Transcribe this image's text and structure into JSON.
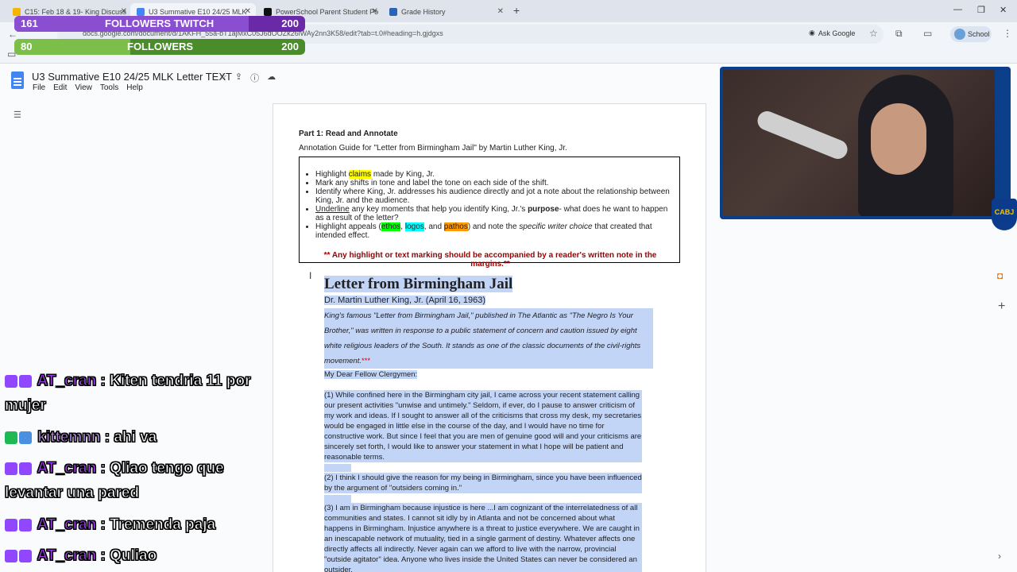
{
  "browser": {
    "tabs": [
      {
        "label": "C15: Feb 18 & 19- King Discuss",
        "color": "#f4b400"
      },
      {
        "label": "U3 Summative E10 24/25 MLK",
        "color": "#4285f4"
      },
      {
        "label": "PowerSchool Parent Student Po",
        "color": "#111111"
      },
      {
        "label": "Grade History",
        "color": "#2a63b5"
      }
    ],
    "url": "docs.google.com/document/d/1AKFH_55a-bT1ajMxC05J6dOOZk26lWAy2nn3K58/edit?tab=t.0#heading=h.gjdgxs",
    "ask_google": "Ask Google",
    "profile": "School"
  },
  "overlay": {
    "twitch": {
      "current": "161",
      "label": "FOLLOWERS TWITCH",
      "goal": "200",
      "progress": 0.805
    },
    "followers": {
      "current": "80",
      "label": "FOLLOWERS",
      "goal": "200",
      "progress": 0.4
    }
  },
  "docs": {
    "title": "U3 Summative E10 24/25 MLK Letter TEXT",
    "menu": [
      "File",
      "Edit",
      "View",
      "Tools",
      "Help"
    ]
  },
  "document": {
    "part_title": "Part 1: Read and Annotate",
    "guide_title": "Annotation Guide for \"Letter from Birmingham Jail\" by Martin Luther King, Jr.",
    "bullets": {
      "b1_pre": "Highlight ",
      "b1_claims": "claims",
      "b1_post": " made by King, Jr.",
      "b2": "Mark any shifts in tone and label the tone on each side of the shift.",
      "b3": "Identify where King, Jr. addresses his audience directly and jot a note about the relationship between King, Jr. and the audience.",
      "b4_under": "Underline",
      "b4_mid": " any key moments that help you identify King, Jr.'s ",
      "b4_bold": "purpose",
      "b4_post": "- what does he want to happen as a result of the letter?",
      "b5_pre": "Highlight appeals (",
      "b5_ethos": "ethos",
      "b5_c1": ", ",
      "b5_logos": "logos",
      "b5_c2": ", and ",
      "b5_pathos": "pathos",
      "b5_mid": ") and note the ",
      "b5_italic": "specific writer choice",
      "b5_post": " that created that intended effect."
    },
    "warning": "** Any highlight or text marking should be accompanied by a reader's written note in the margins.**",
    "letter_title": "Letter from Birmingham Jail",
    "byline": "Dr. Martin Luther King, Jr. (April 16, 1963)",
    "intro": "King's famous \"Letter from Birmingham Jail,\" published in The Atlantic as \"The Negro Is Your Brother,\" was written in response to a public statement of concern and caution issued by eight white religious leaders of the South. It stands as one of the classic documents of the civil-rights movement.",
    "intro_stars": "***",
    "salutation": "My Dear Fellow Clergymen:",
    "para1": "(1) While confined here in the Birmingham city jail, I came across your recent statement calling our present activities \"unwise and untimely.\" Seldom, if ever, do I pause to answer criticism of my work and ideas. If I sought to answer all of the criticisms that cross my desk, my secretaries would be engaged in little else in the course of the day, and I would have no time for constructive work. But since I feel that you are men of genuine good will and your criticisms are sincerely set forth, I would like to answer your statement in what I hope will be patient and reasonable terms.",
    "para2": "(2) I think I should give the reason for my being in Birmingham, since you have been influenced by the argument of \"outsiders coming in.\"",
    "para3": "(3) I am in Birmingham because injustice is here ...I am cognizant of the interrelatedness of all communities and states. I cannot sit idly by in Atlanta and not be concerned about what happens in Birmingham. Injustice anywhere is a threat to justice everywhere. We are caught in an inescapable network of mutuality, tied in a single garment of destiny. Whatever affects one directly affects all indirectly. Never again can we afford to live with the narrow, provincial \"outside agitator\" idea. Anyone who lives inside the United States can never be considered an outsider."
  },
  "webcam": {
    "badge": "CABJ"
  },
  "chat": [
    {
      "user": "AT_cran",
      "sep": " : ",
      "message": "Kiten tendria 11 por mujer"
    },
    {
      "user": "kittemnn",
      "sep": " : ",
      "message": "ahi va"
    },
    {
      "user": "AT_cran",
      "sep": " : ",
      "message": "Qliao tengo que levantar una pared"
    },
    {
      "user": "AT_cran",
      "sep": " : ",
      "message": "Tremenda paja"
    },
    {
      "user": "AT_cran",
      "sep": " : ",
      "message": "Quliao"
    }
  ],
  "colors": {
    "purple_bar": "#6a2aa8",
    "green_bar": "#4a8c2a",
    "selection": "#c3d5f7",
    "warning": "#990000"
  }
}
